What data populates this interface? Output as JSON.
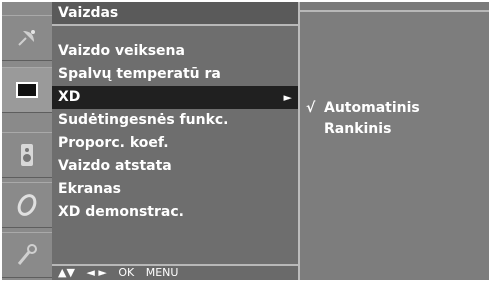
{
  "icons": [
    {
      "name": "satellite-dish-icon"
    },
    {
      "name": "picture-icon"
    },
    {
      "name": "speaker-icon"
    },
    {
      "name": "clock-icon"
    },
    {
      "name": "wrench-icon"
    }
  ],
  "menu": {
    "title": "Vaizdas",
    "items": [
      {
        "label": "Vaizdo veiksena"
      },
      {
        "label": "Spalvų temperatū ra"
      },
      {
        "label": "XD",
        "arrow": "►"
      },
      {
        "label": "Sudėtingesnės funkc."
      },
      {
        "label": "Proporc. koef."
      },
      {
        "label": "Vaizdo atstata"
      },
      {
        "label": "Ekranas"
      },
      {
        "label": "XD demonstrac."
      }
    ],
    "active_index": 2
  },
  "footer": {
    "updown": "▲▼",
    "leftright": "◄ ►",
    "ok": "OK",
    "menu": "MENU"
  },
  "submenu": {
    "items": [
      {
        "label": "Automatinis",
        "check": "√"
      },
      {
        "label": "Rankinis",
        "check": ""
      }
    ]
  },
  "colors": {
    "background": "#7a7a7a",
    "highlight": "#202020",
    "text": "#ffffff"
  }
}
